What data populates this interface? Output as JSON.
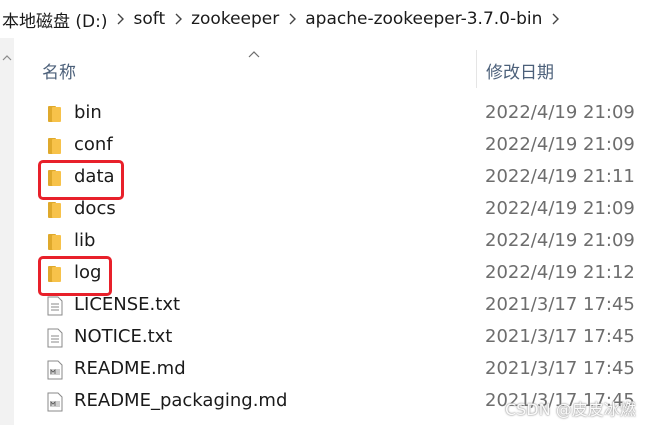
{
  "breadcrumb": {
    "items": [
      "本地磁盘 (D:)",
      "soft",
      "zookeeper",
      "apache-zookeeper-3.7.0-bin"
    ]
  },
  "header": {
    "name_label": "名称",
    "date_label": "修改日期"
  },
  "files": [
    {
      "name": "bin",
      "date": "2022/4/19 21:09",
      "type": "folder"
    },
    {
      "name": "conf",
      "date": "2022/4/19 21:09",
      "type": "folder"
    },
    {
      "name": "data",
      "date": "2022/4/19 21:11",
      "type": "folder"
    },
    {
      "name": "docs",
      "date": "2022/4/19 21:09",
      "type": "folder"
    },
    {
      "name": "lib",
      "date": "2022/4/19 21:09",
      "type": "folder"
    },
    {
      "name": "log",
      "date": "2022/4/19 21:12",
      "type": "folder"
    },
    {
      "name": "LICENSE.txt",
      "date": "2021/3/17 17:45",
      "type": "text"
    },
    {
      "name": "NOTICE.txt",
      "date": "2021/3/17 17:45",
      "type": "text"
    },
    {
      "name": "README.md",
      "date": "2021/3/17 17:45",
      "type": "markdown"
    },
    {
      "name": "README_packaging.md",
      "date": "2021/3/17 17:45",
      "type": "markdown"
    }
  ],
  "highlighted": [
    "data",
    "log"
  ],
  "watermark": "CSDN @皮皮冰燃",
  "colors": {
    "folder": "#f7c24a",
    "highlight": "#e8202a",
    "header_text": "#4c607a",
    "date_text": "#6d6d6d"
  }
}
